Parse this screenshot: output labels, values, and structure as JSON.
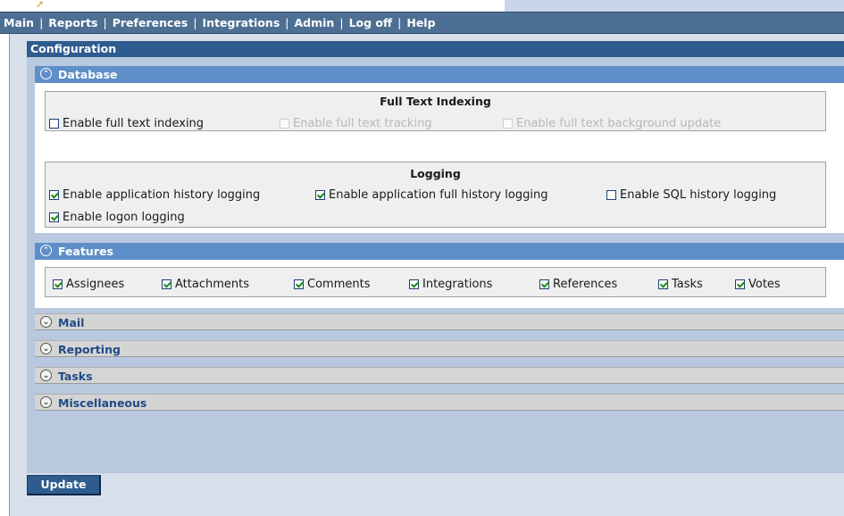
{
  "nav": {
    "items": [
      "Main",
      "Reports",
      "Preferences",
      "Integrations",
      "Admin",
      "Log off",
      "Help"
    ],
    "separator": "|"
  },
  "config": {
    "title": "Configuration",
    "update_label": "Update"
  },
  "database": {
    "title": "Database",
    "fulltext": {
      "title": "Full Text Indexing",
      "options": [
        {
          "label": "Enable full text indexing",
          "checked": false,
          "disabled": false
        },
        {
          "label": "Enable full text tracking",
          "checked": false,
          "disabled": true
        },
        {
          "label": "Enable full text background update",
          "checked": false,
          "disabled": true
        }
      ]
    },
    "logging": {
      "title": "Logging",
      "options": [
        {
          "label": "Enable application history logging",
          "checked": true
        },
        {
          "label": "Enable application full history logging",
          "checked": true
        },
        {
          "label": "Enable SQL history logging",
          "checked": false
        },
        {
          "label": "Enable logon logging",
          "checked": true
        }
      ]
    }
  },
  "features": {
    "title": "Features",
    "options": [
      {
        "label": "Assignees",
        "checked": true
      },
      {
        "label": "Attachments",
        "checked": true
      },
      {
        "label": "Comments",
        "checked": true
      },
      {
        "label": "Integrations",
        "checked": true
      },
      {
        "label": "References",
        "checked": true
      },
      {
        "label": "Tasks",
        "checked": true
      },
      {
        "label": "Votes",
        "checked": true
      }
    ]
  },
  "collapsed_sections": [
    "Mail",
    "Reporting",
    "Tasks",
    "Miscellaneous"
  ],
  "icons": {
    "expanded": "chevron-up-icon",
    "collapsed": "chevron-down-icon",
    "expanded_glyph": "⌃",
    "collapsed_glyph": "⌄"
  }
}
